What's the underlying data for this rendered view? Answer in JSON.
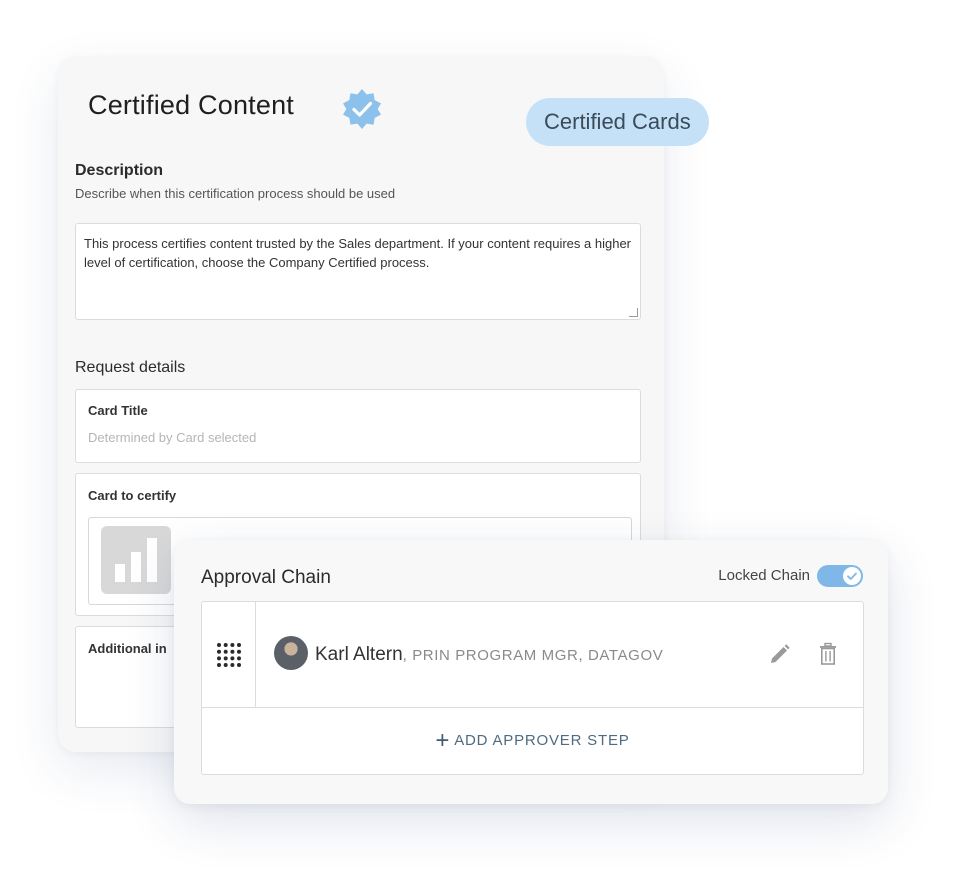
{
  "main_card": {
    "title": "Certified Content",
    "badge_icon": "certified-badge-icon",
    "pill_label": "Certified Cards",
    "description": {
      "heading": "Description",
      "subtitle": "Describe when this certification process should be used",
      "text": "This process certifies content trusted by the Sales department. If your content requires a higher level of certification, choose the Company Certified process."
    },
    "request_details": {
      "heading": "Request details",
      "card_title_label": "Card Title",
      "card_title_placeholder": "Determined by Card selected",
      "card_to_certify_label": "Card to certify",
      "additional_label": "Additional in"
    }
  },
  "approval_chain": {
    "title": "Approval Chain",
    "locked_label": "Locked Chain",
    "locked": true,
    "approvers": [
      {
        "name": "Karl Altern",
        "role": ", PRIN PROGRAM MGR, DATAGOV"
      }
    ],
    "add_step_label": "ADD APPROVER STEP"
  },
  "colors": {
    "pill_bg": "#c4e1f7",
    "badge": "#7fb8e8",
    "toggle": "#7fb8e8",
    "add_step_text": "#4f6b82"
  }
}
